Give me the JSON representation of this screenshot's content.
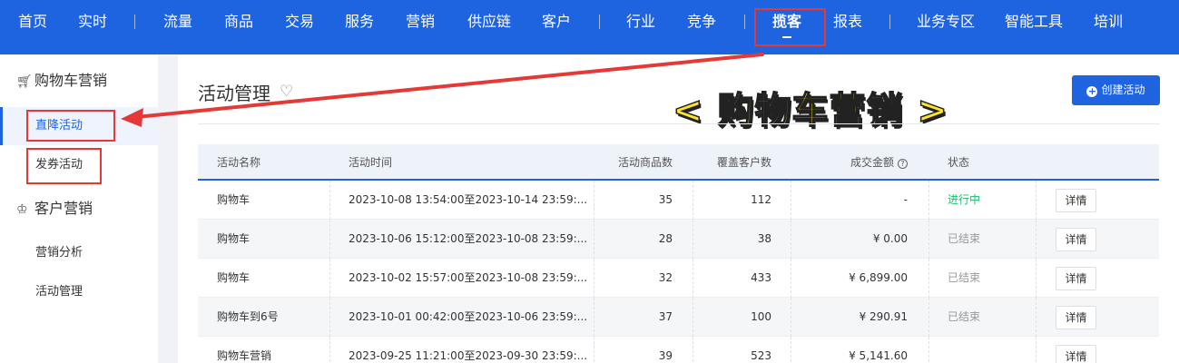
{
  "nav": {
    "items": [
      "首页",
      "实时",
      "流量",
      "商品",
      "交易",
      "服务",
      "营销",
      "供应链",
      "客户",
      "行业",
      "竞争",
      "揽客",
      "报表",
      "业务专区",
      "智能工具",
      "培训"
    ],
    "active": "揽客"
  },
  "sidebar": {
    "group1": "购物车营销",
    "group1_items": [
      "直降活动",
      "发券活动"
    ],
    "group2": "客户营销",
    "group2_items": [
      "营销分析",
      "活动管理"
    ]
  },
  "main": {
    "title": "活动管理",
    "create_button": "创建活动",
    "banner": "< 购物车营销 >"
  },
  "table": {
    "headers": [
      "活动名称",
      "活动时间",
      "活动商品数",
      "覆盖客户数",
      "成交金额",
      "状态"
    ],
    "rows": [
      {
        "name": "购物车",
        "time": "2023-10-08 13:54:00至2023-10-14 23:59:...",
        "products": "35",
        "customers": "112",
        "amount": "-",
        "status": "进行中",
        "action": "详情"
      },
      {
        "name": "购物车",
        "time": "2023-10-06 15:12:00至2023-10-08 23:59:...",
        "products": "28",
        "customers": "38",
        "amount": "¥ 0.00",
        "status": "已结束",
        "action": "详情"
      },
      {
        "name": "购物车",
        "time": "2023-10-02 15:57:00至2023-10-08 23:59:...",
        "products": "32",
        "customers": "433",
        "amount": "¥ 6,899.00",
        "status": "已结束",
        "action": "详情"
      },
      {
        "name": "购物车到6号",
        "time": "2023-10-01 00:42:00至2023-10-06 23:59:...",
        "products": "37",
        "customers": "100",
        "amount": "¥ 290.91",
        "status": "已结束",
        "action": "详情"
      },
      {
        "name": "购物车营销",
        "time": "2023-09-25 11:21:00至2023-09-30 23:59:...",
        "products": "39",
        "customers": "523",
        "amount": "¥ 5,141.60",
        "status": "",
        "action": "详情"
      }
    ]
  },
  "colors": {
    "brand": "#1e63e0",
    "annotation": "#e53935",
    "active_status": "#19be6b",
    "banner": "#fde428"
  }
}
